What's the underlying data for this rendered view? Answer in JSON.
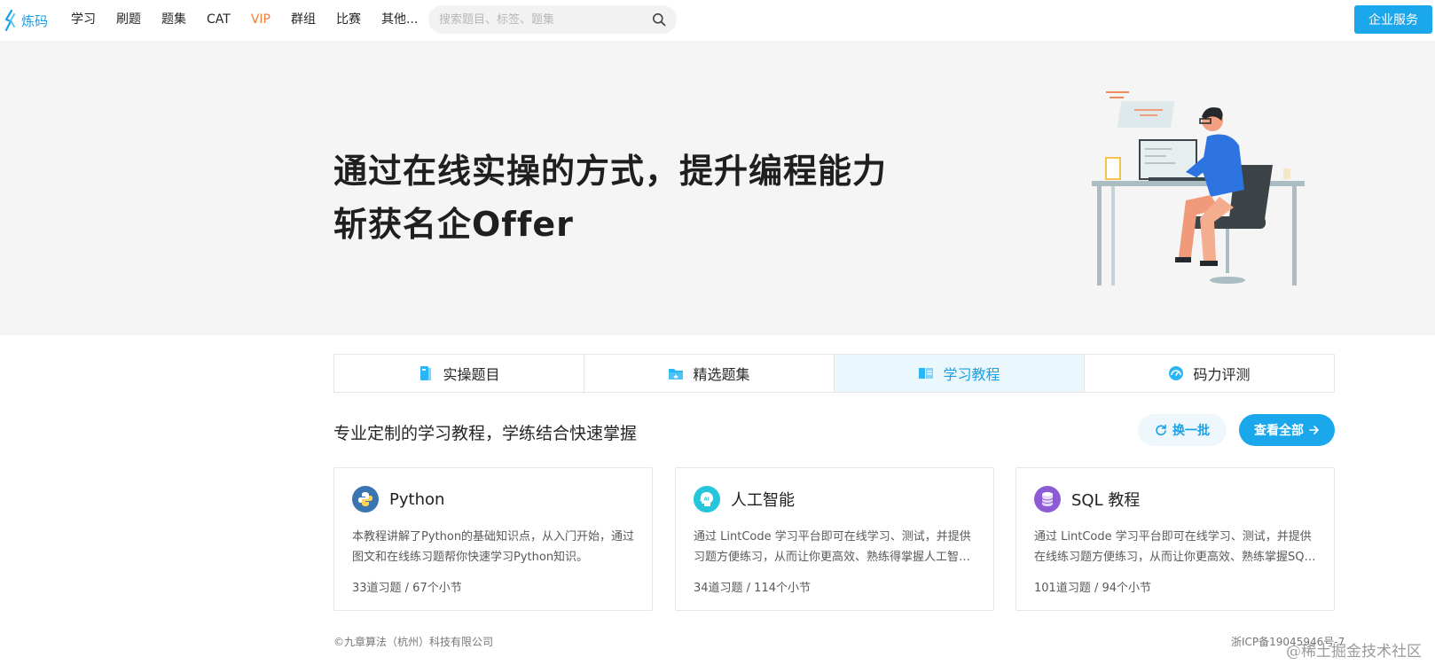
{
  "header": {
    "logo_text": "炼码",
    "nav": [
      {
        "label": "学习"
      },
      {
        "label": "刷题"
      },
      {
        "label": "题集"
      },
      {
        "label": "CAT"
      },
      {
        "label": "VIP",
        "highlight": true
      },
      {
        "label": "群组"
      },
      {
        "label": "比赛"
      },
      {
        "label": "其他..."
      }
    ],
    "search_placeholder": "搜索题目、标签、题集",
    "enterprise_label": "企业服务"
  },
  "hero": {
    "line1": "通过在线实操的方式，提升编程能力",
    "line2": "斩获名企Offer"
  },
  "tabs": [
    {
      "label": "实操题目",
      "icon": "book-icon"
    },
    {
      "label": "精选题集",
      "icon": "folder-icon"
    },
    {
      "label": "学习教程",
      "icon": "tutorial-icon",
      "active": true
    },
    {
      "label": "码力评测",
      "icon": "gauge-icon"
    }
  ],
  "section": {
    "title": "专业定制的学习教程，学练结合快速掌握",
    "refresh_label": "换一批",
    "viewall_label": "查看全部"
  },
  "cards": [
    {
      "title": "Python",
      "icon": "python-icon",
      "description": "本教程讲解了Python的基础知识点，从入门开始，通过图文和在线练习题帮你快速学习Python知识。",
      "meta": "33道习题 / 67个小节"
    },
    {
      "title": "人工智能",
      "icon": "ai-icon",
      "description": "通过 LintCode 学习平台即可在线学习、测试，并提供习题方便练习，从而让你更高效、熟练得掌握人工智能知识。",
      "meta": "34道习题 / 114个小节"
    },
    {
      "title": "SQL 教程",
      "icon": "database-icon",
      "description": "通过 LintCode 学习平台即可在线学习、测试，并提供在线练习题方便练习，从而让你更高效、熟练掌握SQL知识。",
      "meta": "101道习题 / 94个小节"
    }
  ],
  "footer": {
    "copyright": "©九章算法（杭州）科技有限公司",
    "icp": "浙ICP备19045946号-7",
    "watermark": "@稀土掘金技术社区"
  },
  "colors": {
    "accent": "#1aa7ec",
    "vip": "#f07c38",
    "hero_bg": "#f5f5f5"
  }
}
